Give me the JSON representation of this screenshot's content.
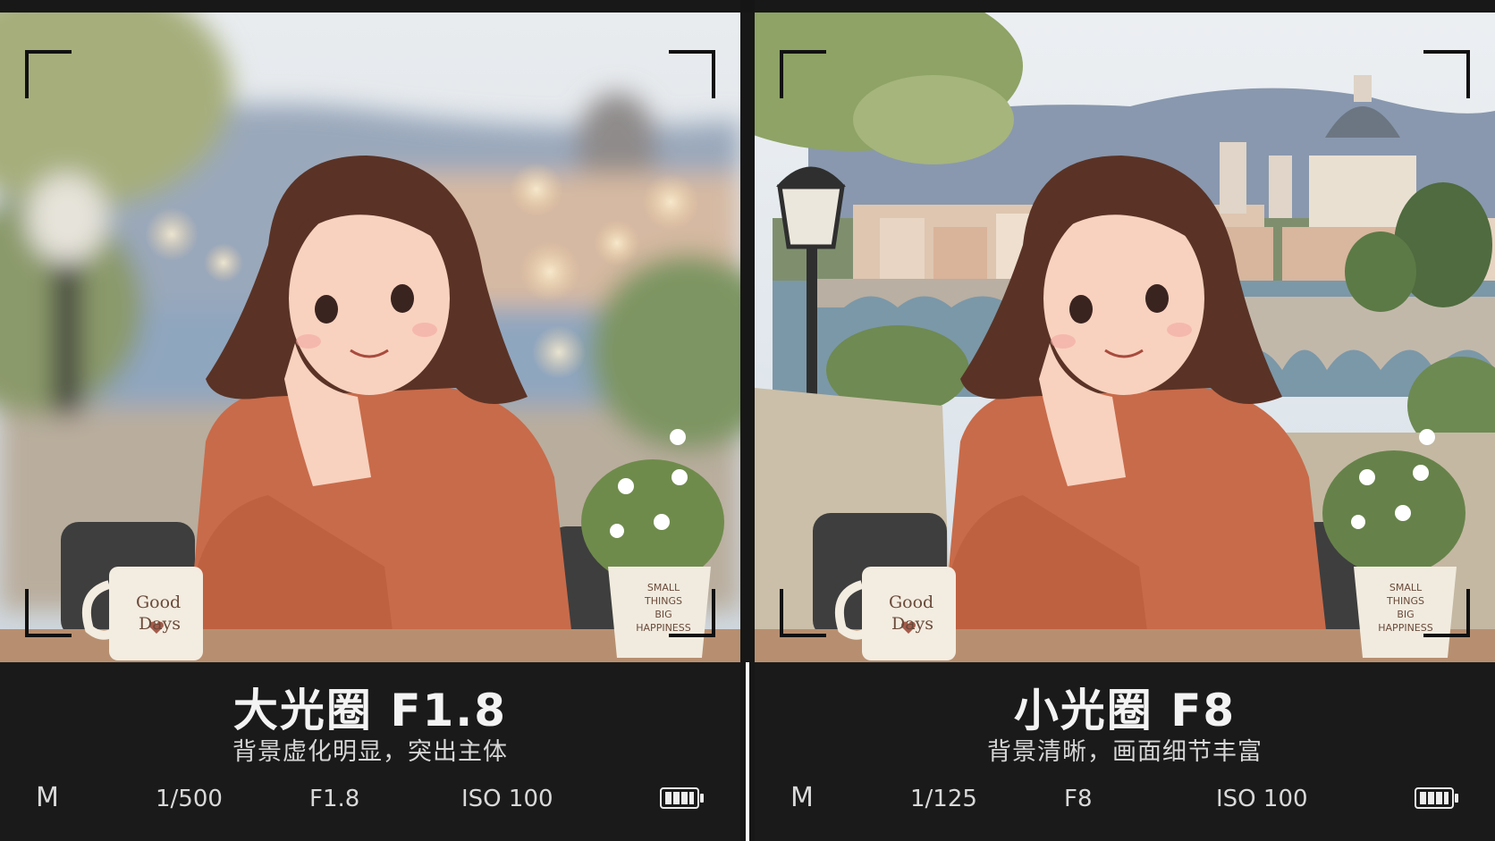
{
  "panels": [
    {
      "title": "大光圈  F1.8",
      "description": "背景虚化明显，突出主体",
      "exif": {
        "mode": "M",
        "shutter": "1/500",
        "aperture": "F1.8",
        "iso": "ISO 100"
      },
      "mug_text": [
        "Good",
        "Days"
      ],
      "pot_text": [
        "SMALL",
        "THINGS",
        "BIG",
        "HAPPINESS"
      ],
      "background_blur": "strong",
      "battery_icon": "battery-full-icon"
    },
    {
      "title": "小光圈 F8",
      "description": "背景清晰，画面细节丰富",
      "exif": {
        "mode": "M",
        "shutter": "1/125",
        "aperture": "F8",
        "iso": "ISO 100"
      },
      "mug_text": [
        "Good",
        "Days"
      ],
      "pot_text": [
        "SMALL",
        "THINGS",
        "BIG",
        "HAPPINESS"
      ],
      "background_blur": "none",
      "battery_icon": "battery-full-icon"
    }
  ],
  "colors": {
    "caption_background": "#1a1a1a",
    "sweater": "#c86b4a",
    "hair": "#5a3326",
    "sky": "#d9e2ea"
  }
}
